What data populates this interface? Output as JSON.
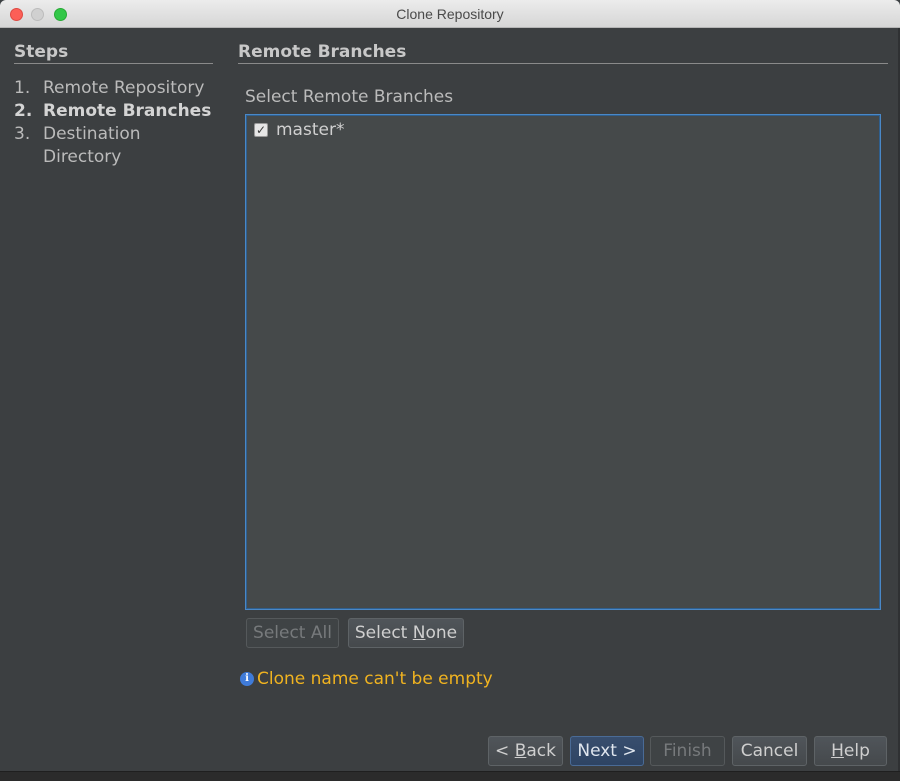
{
  "window": {
    "title": "Clone Repository"
  },
  "steps": {
    "title": "Steps",
    "items": [
      {
        "num": "1.",
        "label": "Remote Repository",
        "active": false
      },
      {
        "num": "2.",
        "label": "Remote Branches",
        "active": true
      },
      {
        "num": "3.",
        "label": "Destination Directory",
        "active": false
      }
    ]
  },
  "content": {
    "title": "Remote Branches",
    "list_label": "Select Remote Branches",
    "branches": [
      {
        "name": "master*",
        "checked": true
      }
    ],
    "select_all": "Select All",
    "select_none_prefix": "Select ",
    "select_none_mnemonic": "N",
    "select_none_suffix": "one",
    "message": "Clone name can't be empty",
    "message_icon": "info-icon",
    "message_color": "#f0b320"
  },
  "footer": {
    "back_prefix": "< ",
    "back_mnemonic": "B",
    "back_suffix": "ack",
    "next": "Next >",
    "finish": "Finish",
    "cancel": "Cancel",
    "help_mnemonic": "H",
    "help_suffix": "elp"
  }
}
